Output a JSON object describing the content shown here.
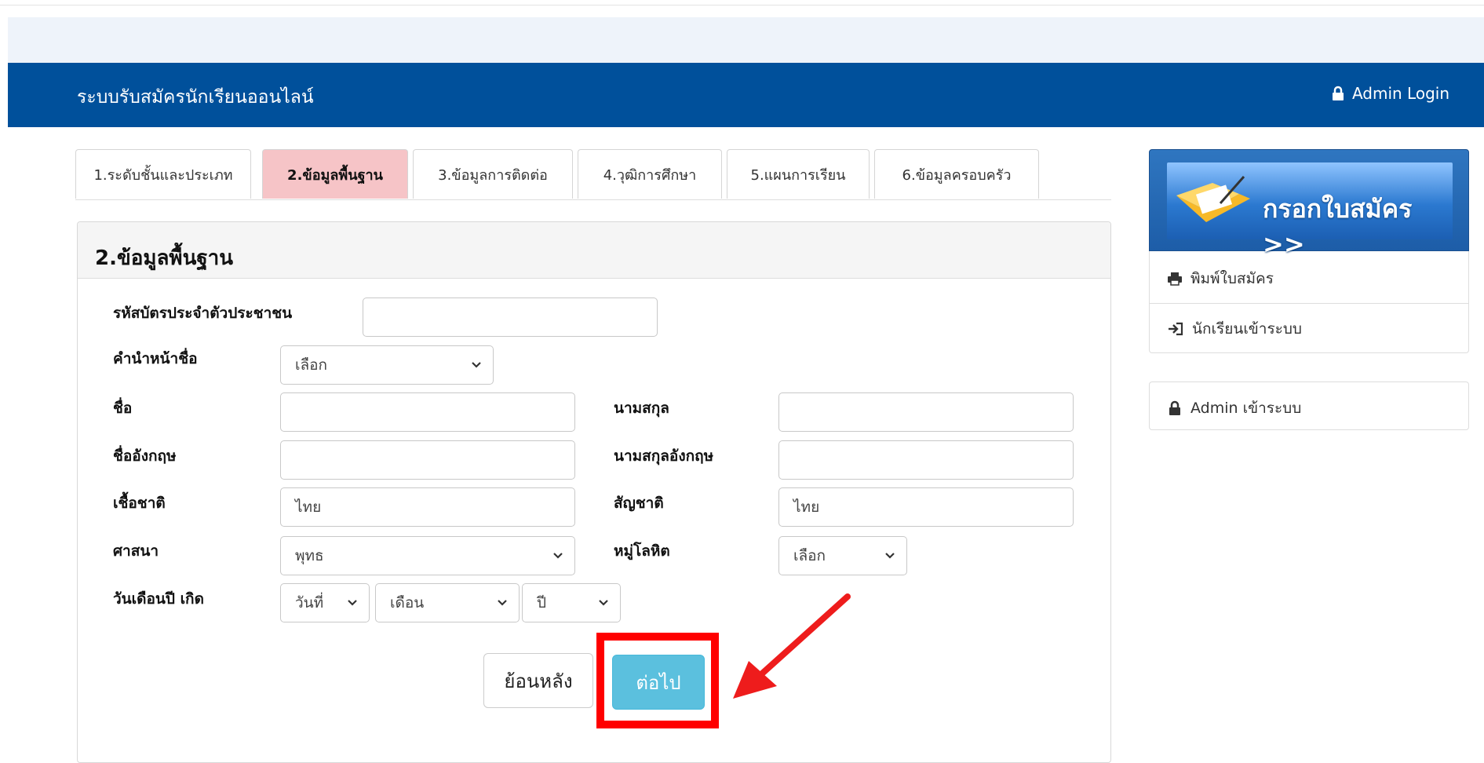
{
  "navbar": {
    "brand": "ระบบรับสมัครนักเรียนออนไลน์",
    "admin_login": "Admin Login"
  },
  "tabs": [
    {
      "label": "1.ระดับชั้นและประเภท"
    },
    {
      "label": "2.ข้อมูลพื้นฐาน",
      "active": true
    },
    {
      "label": "3.ข้อมูลการติดต่อ"
    },
    {
      "label": "4.วุฒิการศึกษา"
    },
    {
      "label": "5.แผนการเรียน"
    },
    {
      "label": "6.ข้อมูลครอบครัว"
    }
  ],
  "panel": {
    "title": "2.ข้อมูลพื้นฐาน"
  },
  "form": {
    "id_card_label": "รหัสบัตรประจำตัวประชาชน",
    "id_card_value": "",
    "prefix_label": "คำนำหน้าชื่อ",
    "prefix_value": "เลือก",
    "first_name_label": "ชื่อ",
    "first_name_value": "",
    "last_name_label": "นามสกุล",
    "last_name_value": "",
    "first_name_en_label": "ชื่ออังกฤษ",
    "first_name_en_value": "",
    "last_name_en_label": "นามสกุลอังกฤษ",
    "last_name_en_value": "",
    "race_label": "เชื้อชาติ",
    "race_value": "ไทย",
    "nationality_label": "สัญชาติ",
    "nationality_value": "ไทย",
    "religion_label": "ศาสนา",
    "religion_value": "พุทธ",
    "blood_label": "หมู่โลหิต",
    "blood_value": "เลือก",
    "dob_label": "วันเดือนปี เกิด",
    "dob_day": "วันที่",
    "dob_month": "เดือน",
    "dob_year": "ปี"
  },
  "buttons": {
    "back": "ย้อนหลัง",
    "next": "ต่อไป"
  },
  "sidebar": {
    "banner": "กรอกใบสมัคร >>",
    "print": "พิมพ์ใบสมัคร",
    "student_login": "นักเรียนเข้าระบบ",
    "admin_login": "Admin เข้าระบบ"
  },
  "colors": {
    "navbar": "#00509b",
    "active_tab": "#f6c4c7",
    "next_button": "#5bc0de",
    "highlight": "#ff0000"
  }
}
